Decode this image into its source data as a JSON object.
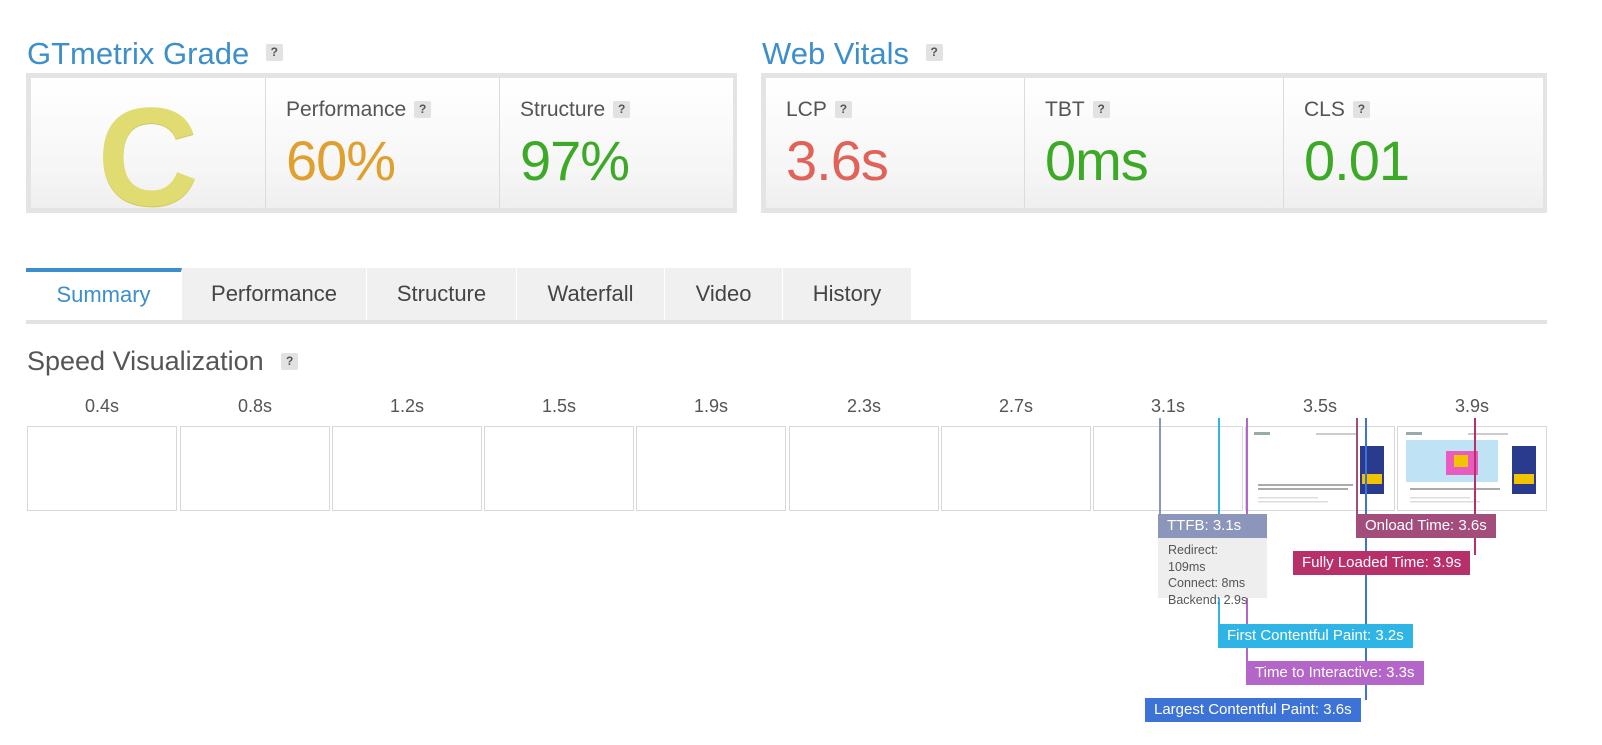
{
  "grade_section": {
    "title": "GTmetrix Grade",
    "grade": "C",
    "performance": {
      "label": "Performance",
      "value": "60%"
    },
    "structure": {
      "label": "Structure",
      "value": "97%"
    }
  },
  "vitals_section": {
    "title": "Web Vitals",
    "lcp": {
      "label": "LCP",
      "value": "3.6s"
    },
    "tbt": {
      "label": "TBT",
      "value": "0ms"
    },
    "cls": {
      "label": "CLS",
      "value": "0.01"
    }
  },
  "help_glyph": "?",
  "tabs": [
    {
      "label": "Summary",
      "active": true
    },
    {
      "label": "Performance"
    },
    {
      "label": "Structure"
    },
    {
      "label": "Waterfall"
    },
    {
      "label": "Video"
    },
    {
      "label": "History"
    }
  ],
  "speed": {
    "title": "Speed Visualization",
    "ticks": [
      "0.4s",
      "0.8s",
      "1.2s",
      "1.5s",
      "1.9s",
      "2.3s",
      "2.7s",
      "3.1s",
      "3.5s",
      "3.9s"
    ],
    "markers": {
      "ttfb": "TTFB: 3.1s",
      "ttfb_details": [
        "Redirect: 109ms",
        "Connect: 8ms",
        "Backend: 2.9s"
      ],
      "onload": "Onload Time: 3.6s",
      "fully_loaded": "Fully Loaded Time: 3.9s",
      "fcp": "First Contentful Paint: 3.2s",
      "tti": "Time to Interactive: 3.3s",
      "lcp": "Largest Contentful Paint: 3.6s"
    }
  },
  "colors": {
    "accent": "#3d8fcc",
    "grade_c": "#e0dc72",
    "performance": "#e0a030",
    "good": "#3caa26",
    "bad": "#e06258",
    "ttfb": "#8b96ba",
    "onload": "#a24d7c",
    "fully_loaded": "#b8306a",
    "fcp": "#2fb5e5",
    "tti": "#b466c8",
    "lcp": "#3d73d6"
  }
}
